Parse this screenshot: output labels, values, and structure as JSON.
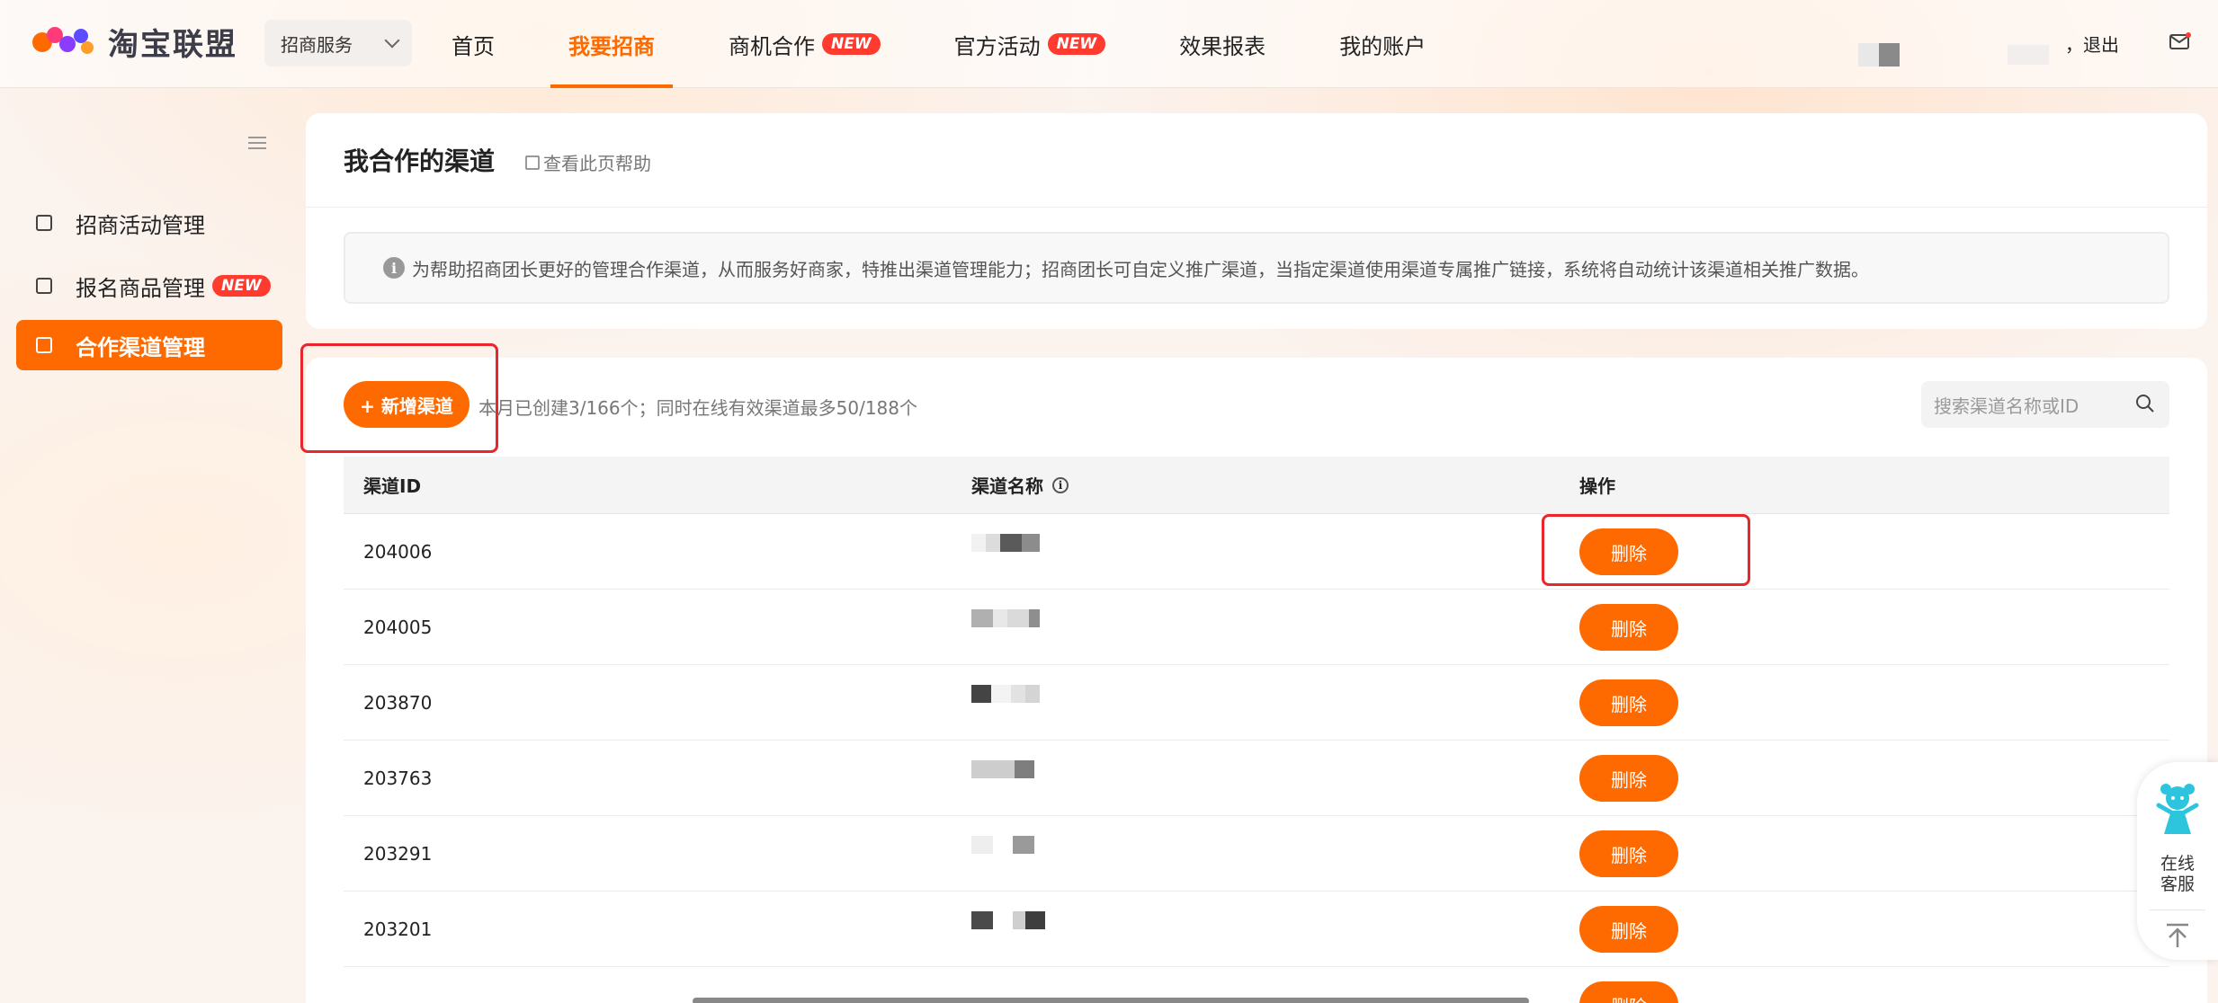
{
  "brand": {
    "name": "淘宝联盟"
  },
  "service_select": {
    "value": "招商服务"
  },
  "nav": {
    "items": [
      {
        "label": "首页",
        "badge": ""
      },
      {
        "label": "我要招商",
        "badge": ""
      },
      {
        "label": "商机合作",
        "badge": "NEW"
      },
      {
        "label": "官方活动",
        "badge": "NEW"
      },
      {
        "label": "效果报表",
        "badge": ""
      },
      {
        "label": "我的账户",
        "badge": ""
      }
    ],
    "active_index": 1
  },
  "user": {
    "logout": "，退出"
  },
  "sidebar": {
    "items": [
      {
        "label": "招商活动管理",
        "badge": ""
      },
      {
        "label": "报名商品管理",
        "badge": "NEW"
      },
      {
        "label": "合作渠道管理",
        "badge": ""
      }
    ],
    "active_index": 2
  },
  "page": {
    "title": "我合作的渠道",
    "help_link": "查看此页帮助",
    "notice": "为帮助招商团长更好的管理合作渠道，从而服务好商家，特推出渠道管理能力；招商团长可自定义推广渠道，当指定渠道使用渠道专属推广链接，系统将自动统计该渠道相关推广数据。"
  },
  "toolbar": {
    "add_label": "+ 新增渠道",
    "quota_text": "本月已创建3/166个；同时在线有效渠道最多50/188个",
    "search_placeholder": "搜索渠道名称或ID"
  },
  "table": {
    "headers": [
      "渠道ID",
      "渠道名称",
      "操作"
    ],
    "rows": [
      {
        "id": "204006",
        "action": "删除"
      },
      {
        "id": "204005",
        "action": "删除"
      },
      {
        "id": "203870",
        "action": "删除"
      },
      {
        "id": "203763",
        "action": "删除"
      },
      {
        "id": "203291",
        "action": "删除"
      },
      {
        "id": "203201",
        "action": "删除"
      },
      {
        "id": "",
        "action": "删除"
      }
    ]
  },
  "float_widget": {
    "label_line1": "在线",
    "label_line2": "客服"
  },
  "colors": {
    "accent": "#ff6a00",
    "badge": "#ff3b2f",
    "highlight_box": "#e8262b"
  }
}
